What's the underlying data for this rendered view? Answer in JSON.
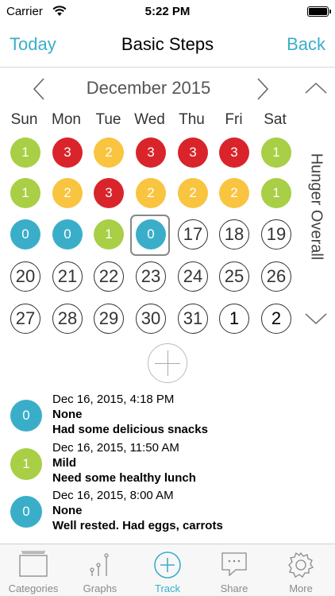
{
  "status": {
    "carrier": "Carrier",
    "time": "5:22 PM"
  },
  "nav": {
    "left": "Today",
    "title": "Basic Steps",
    "right": "Back"
  },
  "calendar": {
    "month": "December 2015",
    "side_label": "Hunger Overall",
    "weekdays": [
      "Sun",
      "Mon",
      "Tue",
      "Wed",
      "Thu",
      "Fri",
      "Sat"
    ],
    "rows": [
      [
        {
          "t": "1",
          "c": "green"
        },
        {
          "t": "3",
          "c": "red"
        },
        {
          "t": "2",
          "c": "yellow"
        },
        {
          "t": "3",
          "c": "red"
        },
        {
          "t": "3",
          "c": "red"
        },
        {
          "t": "3",
          "c": "red"
        },
        {
          "t": "1",
          "c": "green"
        }
      ],
      [
        {
          "t": "1",
          "c": "green"
        },
        {
          "t": "2",
          "c": "yellow"
        },
        {
          "t": "3",
          "c": "red"
        },
        {
          "t": "2",
          "c": "yellow"
        },
        {
          "t": "2",
          "c": "yellow"
        },
        {
          "t": "2",
          "c": "yellow"
        },
        {
          "t": "1",
          "c": "green"
        }
      ],
      [
        {
          "t": "0",
          "c": "teal"
        },
        {
          "t": "0",
          "c": "teal"
        },
        {
          "t": "1",
          "c": "green"
        },
        {
          "t": "0",
          "c": "teal"
        },
        {
          "t": "17",
          "c": "plain"
        },
        {
          "t": "18",
          "c": "plain"
        },
        {
          "t": "19",
          "c": "plain"
        }
      ],
      [
        {
          "t": "20",
          "c": "plain"
        },
        {
          "t": "21",
          "c": "plain"
        },
        {
          "t": "22",
          "c": "plain"
        },
        {
          "t": "23",
          "c": "plain"
        },
        {
          "t": "24",
          "c": "plain"
        },
        {
          "t": "25",
          "c": "plain"
        },
        {
          "t": "26",
          "c": "plain"
        }
      ],
      [
        {
          "t": "27",
          "c": "plain"
        },
        {
          "t": "28",
          "c": "plain"
        },
        {
          "t": "29",
          "c": "plain"
        },
        {
          "t": "30",
          "c": "plain"
        },
        {
          "t": "31",
          "c": "plain"
        },
        {
          "t": "1",
          "c": "future"
        },
        {
          "t": "2",
          "c": "future"
        }
      ]
    ],
    "selected": "Dec 16"
  },
  "entries": [
    {
      "badge": "0",
      "color": "teal",
      "time": "Dec 16, 2015, 4:18 PM",
      "level": "None",
      "note": "Had some delicious snacks"
    },
    {
      "badge": "1",
      "color": "green",
      "time": "Dec 16, 2015, 11:50 AM",
      "level": "Mild",
      "note": "Need some healthy lunch"
    },
    {
      "badge": "0",
      "color": "teal",
      "time": "Dec 16, 2015, 8:00 AM",
      "level": "None",
      "note": "Well rested. Had eggs, carrots"
    }
  ],
  "tabs": [
    {
      "label": "Categories",
      "icon": "categories-icon"
    },
    {
      "label": "Graphs",
      "icon": "graphs-icon"
    },
    {
      "label": "Track",
      "icon": "track-icon",
      "active": true
    },
    {
      "label": "Share",
      "icon": "share-icon"
    },
    {
      "label": "More",
      "icon": "gear-icon"
    }
  ],
  "colors": {
    "accent": "#3aaec9",
    "green": "#a8cf45",
    "yellow": "#f9c440",
    "red": "#d9242b",
    "teal": "#3aaec9"
  }
}
